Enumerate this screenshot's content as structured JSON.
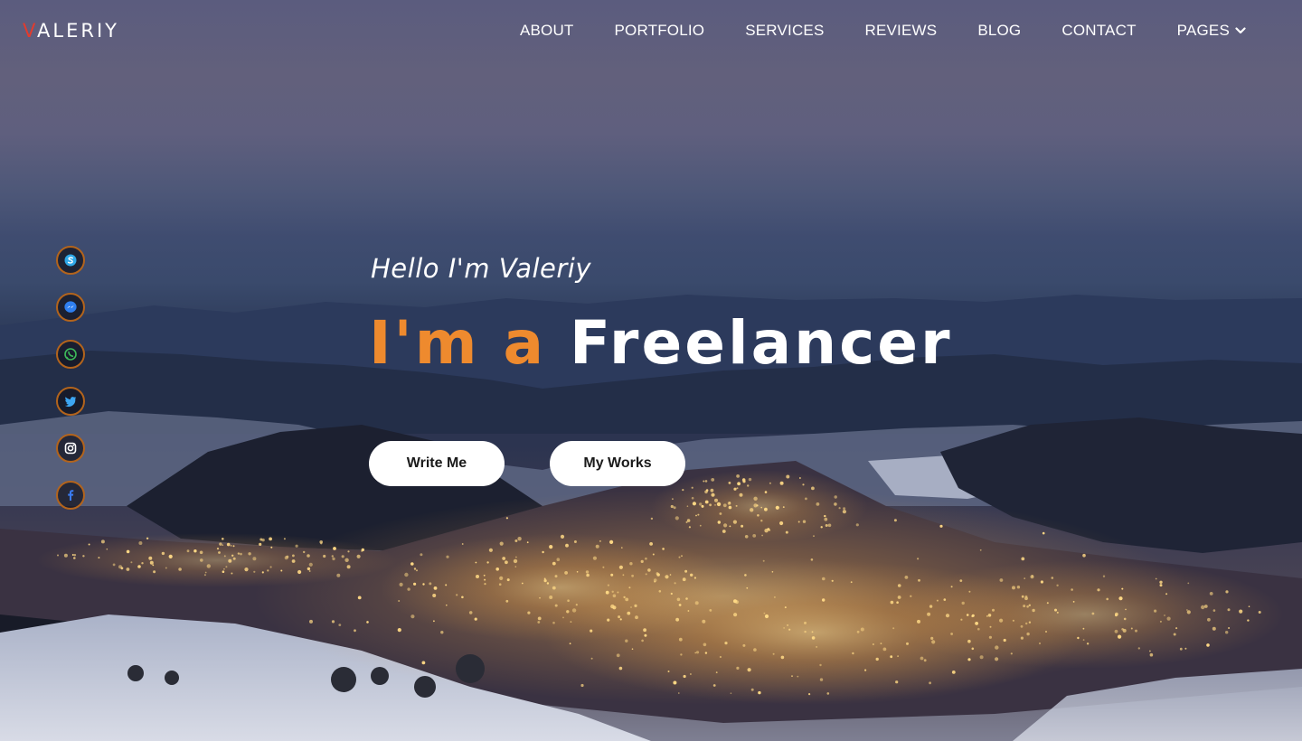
{
  "brand": {
    "logo_first": "V",
    "logo_rest": "ALERIY"
  },
  "nav": {
    "items": [
      {
        "label": "ABOUT"
      },
      {
        "label": "PORTFOLIO"
      },
      {
        "label": "SERVICES"
      },
      {
        "label": "REVIEWS"
      },
      {
        "label": "BLOG"
      },
      {
        "label": "CONTACT"
      },
      {
        "label": "PAGES",
        "icon": "chevron-down-icon"
      }
    ]
  },
  "hero": {
    "greeting": "Hello I'm Valeriy",
    "headline_accent": "I'm a",
    "headline_role": "Freelancer",
    "buttons": {
      "write_me": "Write Me",
      "my_works": "My Works"
    }
  },
  "socials": [
    {
      "name": "skype-icon"
    },
    {
      "name": "messenger-icon"
    },
    {
      "name": "whatsapp-icon"
    },
    {
      "name": "twitter-icon"
    },
    {
      "name": "instagram-icon"
    },
    {
      "name": "facebook-icon"
    }
  ],
  "colors": {
    "accent": "#ee8a2e",
    "logo_accent": "#e23b2e",
    "social_border": "#b3641c",
    "button_bg": "#ffffff",
    "button_text": "#1a1a1a"
  }
}
